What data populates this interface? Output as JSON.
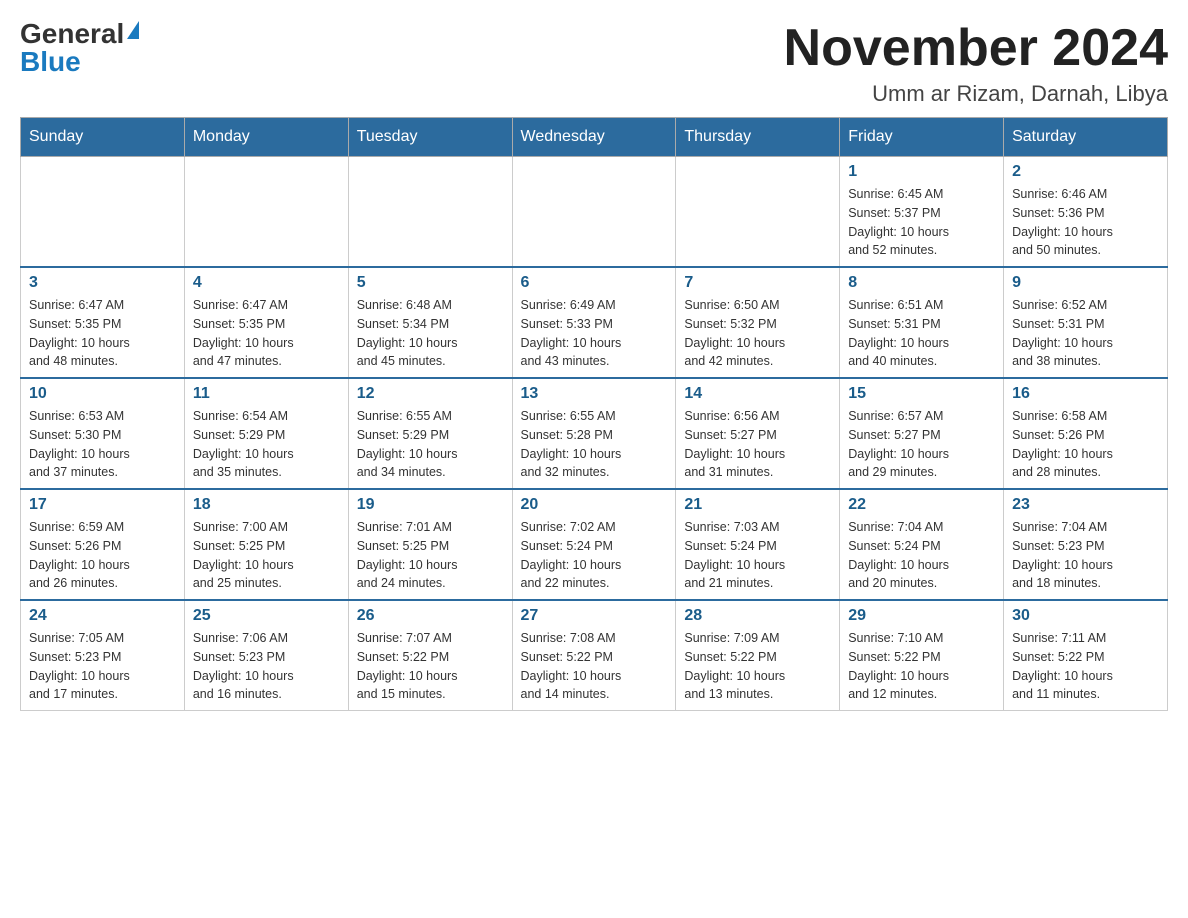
{
  "header": {
    "logo_general": "General",
    "logo_blue": "Blue",
    "month_title": "November 2024",
    "location": "Umm ar Rizam, Darnah, Libya"
  },
  "weekdays": [
    "Sunday",
    "Monday",
    "Tuesday",
    "Wednesday",
    "Thursday",
    "Friday",
    "Saturday"
  ],
  "weeks": [
    [
      {
        "day": "",
        "info": ""
      },
      {
        "day": "",
        "info": ""
      },
      {
        "day": "",
        "info": ""
      },
      {
        "day": "",
        "info": ""
      },
      {
        "day": "",
        "info": ""
      },
      {
        "day": "1",
        "info": "Sunrise: 6:45 AM\nSunset: 5:37 PM\nDaylight: 10 hours\nand 52 minutes."
      },
      {
        "day": "2",
        "info": "Sunrise: 6:46 AM\nSunset: 5:36 PM\nDaylight: 10 hours\nand 50 minutes."
      }
    ],
    [
      {
        "day": "3",
        "info": "Sunrise: 6:47 AM\nSunset: 5:35 PM\nDaylight: 10 hours\nand 48 minutes."
      },
      {
        "day": "4",
        "info": "Sunrise: 6:47 AM\nSunset: 5:35 PM\nDaylight: 10 hours\nand 47 minutes."
      },
      {
        "day": "5",
        "info": "Sunrise: 6:48 AM\nSunset: 5:34 PM\nDaylight: 10 hours\nand 45 minutes."
      },
      {
        "day": "6",
        "info": "Sunrise: 6:49 AM\nSunset: 5:33 PM\nDaylight: 10 hours\nand 43 minutes."
      },
      {
        "day": "7",
        "info": "Sunrise: 6:50 AM\nSunset: 5:32 PM\nDaylight: 10 hours\nand 42 minutes."
      },
      {
        "day": "8",
        "info": "Sunrise: 6:51 AM\nSunset: 5:31 PM\nDaylight: 10 hours\nand 40 minutes."
      },
      {
        "day": "9",
        "info": "Sunrise: 6:52 AM\nSunset: 5:31 PM\nDaylight: 10 hours\nand 38 minutes."
      }
    ],
    [
      {
        "day": "10",
        "info": "Sunrise: 6:53 AM\nSunset: 5:30 PM\nDaylight: 10 hours\nand 37 minutes."
      },
      {
        "day": "11",
        "info": "Sunrise: 6:54 AM\nSunset: 5:29 PM\nDaylight: 10 hours\nand 35 minutes."
      },
      {
        "day": "12",
        "info": "Sunrise: 6:55 AM\nSunset: 5:29 PM\nDaylight: 10 hours\nand 34 minutes."
      },
      {
        "day": "13",
        "info": "Sunrise: 6:55 AM\nSunset: 5:28 PM\nDaylight: 10 hours\nand 32 minutes."
      },
      {
        "day": "14",
        "info": "Sunrise: 6:56 AM\nSunset: 5:27 PM\nDaylight: 10 hours\nand 31 minutes."
      },
      {
        "day": "15",
        "info": "Sunrise: 6:57 AM\nSunset: 5:27 PM\nDaylight: 10 hours\nand 29 minutes."
      },
      {
        "day": "16",
        "info": "Sunrise: 6:58 AM\nSunset: 5:26 PM\nDaylight: 10 hours\nand 28 minutes."
      }
    ],
    [
      {
        "day": "17",
        "info": "Sunrise: 6:59 AM\nSunset: 5:26 PM\nDaylight: 10 hours\nand 26 minutes."
      },
      {
        "day": "18",
        "info": "Sunrise: 7:00 AM\nSunset: 5:25 PM\nDaylight: 10 hours\nand 25 minutes."
      },
      {
        "day": "19",
        "info": "Sunrise: 7:01 AM\nSunset: 5:25 PM\nDaylight: 10 hours\nand 24 minutes."
      },
      {
        "day": "20",
        "info": "Sunrise: 7:02 AM\nSunset: 5:24 PM\nDaylight: 10 hours\nand 22 minutes."
      },
      {
        "day": "21",
        "info": "Sunrise: 7:03 AM\nSunset: 5:24 PM\nDaylight: 10 hours\nand 21 minutes."
      },
      {
        "day": "22",
        "info": "Sunrise: 7:04 AM\nSunset: 5:24 PM\nDaylight: 10 hours\nand 20 minutes."
      },
      {
        "day": "23",
        "info": "Sunrise: 7:04 AM\nSunset: 5:23 PM\nDaylight: 10 hours\nand 18 minutes."
      }
    ],
    [
      {
        "day": "24",
        "info": "Sunrise: 7:05 AM\nSunset: 5:23 PM\nDaylight: 10 hours\nand 17 minutes."
      },
      {
        "day": "25",
        "info": "Sunrise: 7:06 AM\nSunset: 5:23 PM\nDaylight: 10 hours\nand 16 minutes."
      },
      {
        "day": "26",
        "info": "Sunrise: 7:07 AM\nSunset: 5:22 PM\nDaylight: 10 hours\nand 15 minutes."
      },
      {
        "day": "27",
        "info": "Sunrise: 7:08 AM\nSunset: 5:22 PM\nDaylight: 10 hours\nand 14 minutes."
      },
      {
        "day": "28",
        "info": "Sunrise: 7:09 AM\nSunset: 5:22 PM\nDaylight: 10 hours\nand 13 minutes."
      },
      {
        "day": "29",
        "info": "Sunrise: 7:10 AM\nSunset: 5:22 PM\nDaylight: 10 hours\nand 12 minutes."
      },
      {
        "day": "30",
        "info": "Sunrise: 7:11 AM\nSunset: 5:22 PM\nDaylight: 10 hours\nand 11 minutes."
      }
    ]
  ]
}
